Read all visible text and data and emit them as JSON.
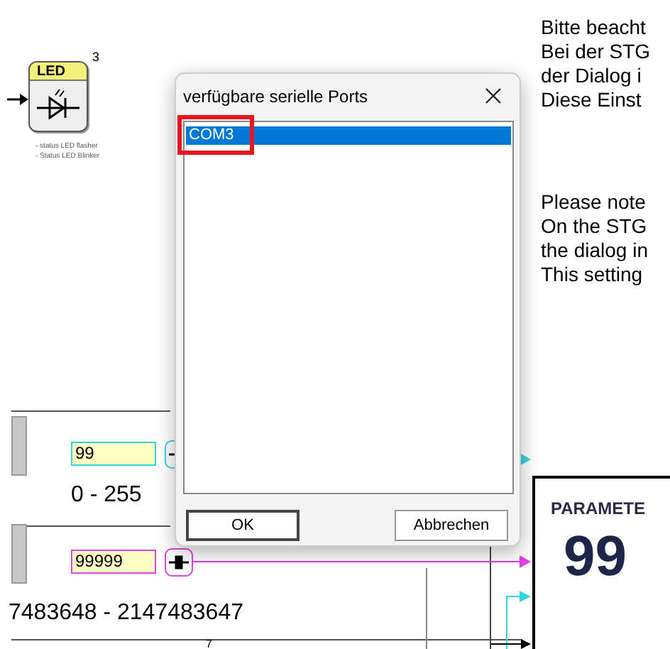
{
  "led_block": {
    "label": "LED",
    "number": "3",
    "captions": [
      "- status LED flasher",
      "- Status LED Blinker"
    ]
  },
  "notes": [
    {
      "lines": [
        "Bitte beacht",
        "Bei der STG",
        "der Dialog i",
        "Diese Einst"
      ]
    },
    {
      "lines": [
        "Please note",
        "On the STG",
        "the dialog in",
        "This setting"
      ]
    }
  ],
  "inputs": [
    {
      "value": "99",
      "range": "0 - 255",
      "color": "#33d6e0"
    },
    {
      "value": "99999",
      "range": "7483648 - 2147483647",
      "color": "#e040e0"
    }
  ],
  "page_number": "7",
  "parameter": {
    "title": "PARAMETE",
    "value": "99"
  },
  "dialog": {
    "title": "verfügbare serielle Ports",
    "ports": [
      {
        "label": "COM3",
        "selected": true,
        "highlighted": true
      }
    ],
    "buttons": [
      {
        "label": "OK",
        "default": true
      },
      {
        "label": "Abbrechen",
        "default": false
      }
    ]
  }
}
